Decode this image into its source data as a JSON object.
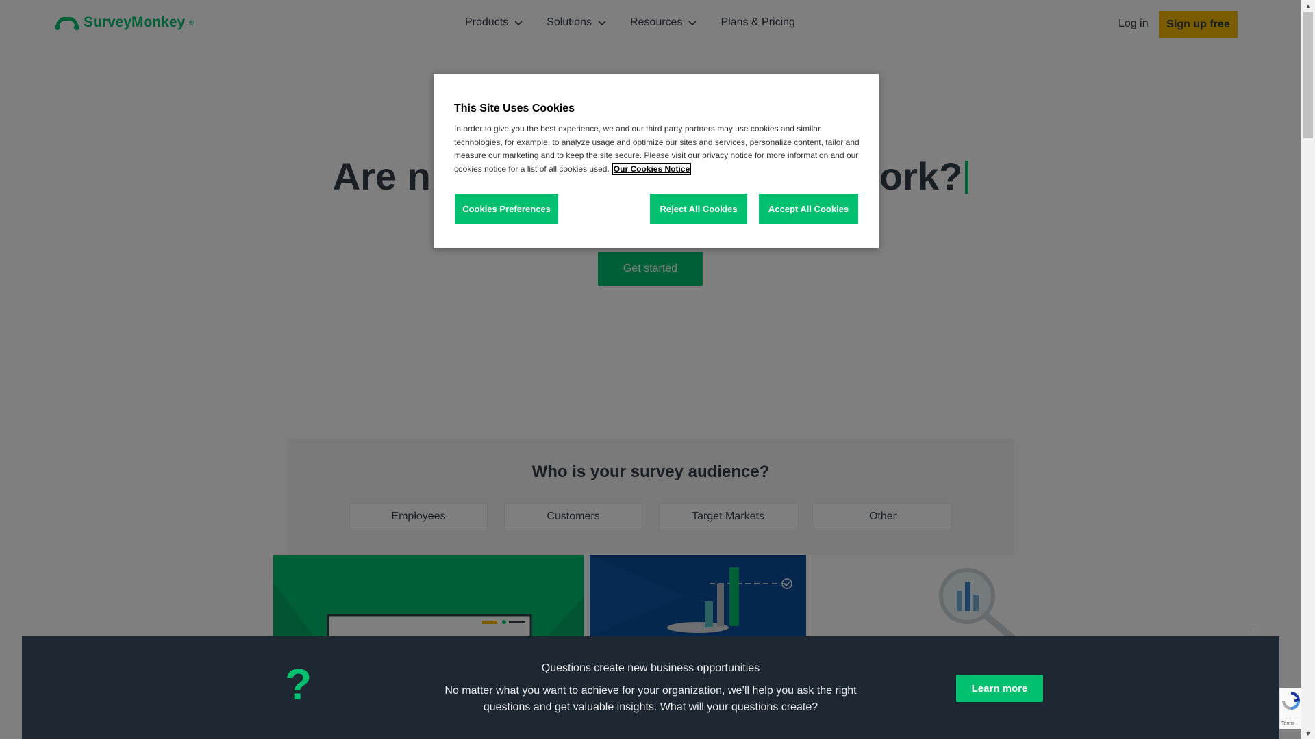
{
  "header": {
    "logo_text": "SurveyMonkey",
    "logo_mark": "®",
    "nav": [
      {
        "label": "Products"
      },
      {
        "label": "Solutions"
      },
      {
        "label": "Resources"
      },
      {
        "label": "Plans & Pricing"
      }
    ],
    "login_label": "Log in",
    "signup_label": "Sign up free"
  },
  "hero": {
    "title_visible_left": "Are n",
    "title_visible_right": "ork?",
    "get_started_label": "Get started"
  },
  "audience": {
    "title": "Who is your survey audience?",
    "tabs": [
      "Employees",
      "Customers",
      "Target Markets",
      "Other"
    ]
  },
  "cookie_modal": {
    "title": "This Site Uses Cookies",
    "body": "In order to give you the best experience, we and our third party partners may use cookies and similar technologies, for example, to analyze usage and optimize our sites and services, personalize content, tailor and measure our marketing and to keep the site secure. Please visit our privacy notice for more information and our cookies notice for a list of all cookies used.",
    "link_label": "Our Cookies Notice",
    "preferences_label": "Cookies Preferences",
    "reject_label": "Reject All Cookies",
    "accept_label": "Accept All Cookies"
  },
  "banner": {
    "icon": "question-mark-icon",
    "title": "Questions create new business opportunities",
    "text": "No matter what you want to achieve for your organization, we’ll help you ask the right questions and get valuable insights. What will your questions create?",
    "learn_more_label": "Learn more"
  },
  "recaptcha": {
    "terms": "Terms"
  },
  "colors": {
    "brand_green": "#00bf6f",
    "signup_yellow": "#f2b600",
    "banner_bg": "#1e2833",
    "text_dark": "#333e48"
  }
}
